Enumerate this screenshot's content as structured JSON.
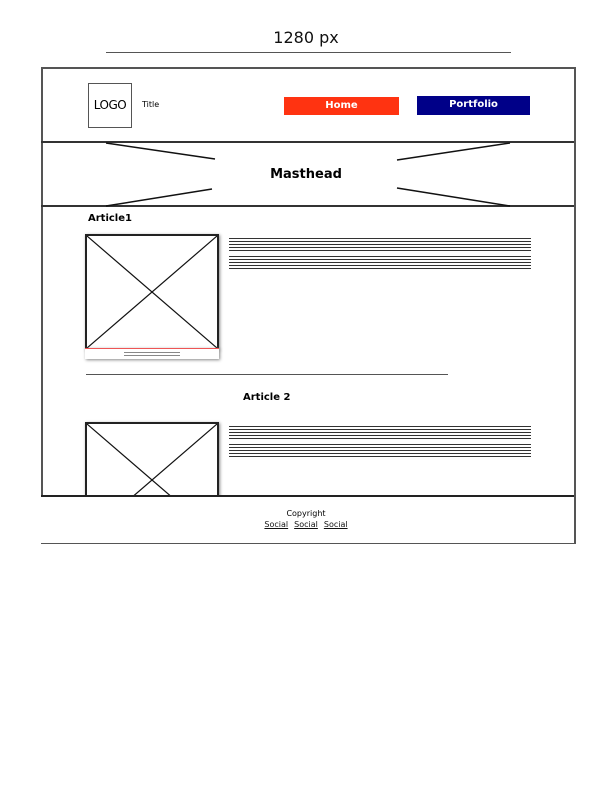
{
  "width_label": "1280 px",
  "header": {
    "logo": "LOGO",
    "title": "Title",
    "nav": [
      {
        "label": "Home",
        "color": "#ff3311"
      },
      {
        "label": "Portfolio",
        "color": "#000088"
      }
    ]
  },
  "masthead": {
    "label": "Masthead"
  },
  "articles": [
    {
      "title": "Article1"
    },
    {
      "title": "Article 2"
    }
  ],
  "footer": {
    "copyright": "Copyright",
    "social": [
      "Social",
      "Social",
      "Social"
    ]
  }
}
